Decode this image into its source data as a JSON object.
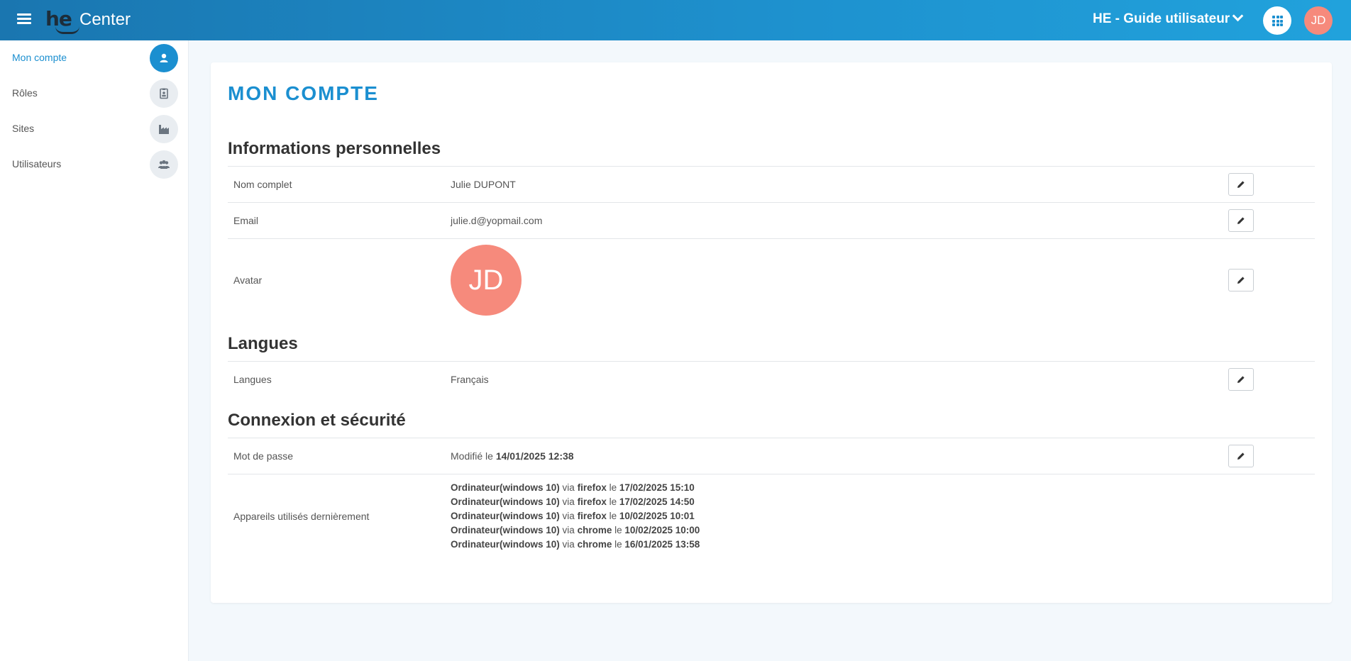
{
  "app": {
    "name": "Center",
    "logo_text": "he"
  },
  "header": {
    "site_selector": "HE - Guide utilisateur",
    "avatar_initials": "JD"
  },
  "colors": {
    "brand": "#1b8fd0",
    "avatar": "#f68a7c",
    "topbar_start": "#1a76b0",
    "topbar_end": "#21a2dc"
  },
  "sidebar": {
    "items": [
      {
        "label": "Mon compte",
        "icon": "user-icon",
        "active": true
      },
      {
        "label": "Rôles",
        "icon": "badge-icon",
        "active": false
      },
      {
        "label": "Sites",
        "icon": "factory-icon",
        "active": false
      },
      {
        "label": "Utilisateurs",
        "icon": "users-icon",
        "active": false
      }
    ]
  },
  "main": {
    "title": "MON COMPTE",
    "sections": {
      "personal": {
        "title": "Informations personnelles",
        "full_name_label": "Nom complet",
        "full_name": "Julie DUPONT",
        "email_label": "Email",
        "email": "julie.d@yopmail.com",
        "avatar_label": "Avatar",
        "avatar_initials": "JD"
      },
      "languages": {
        "title": "Langues",
        "label": "Langues",
        "value": "Français"
      },
      "security": {
        "title": "Connexion et sécurité",
        "password_label": "Mot de passe",
        "password_prefix": "Modifié le",
        "password_date": "14/01/2025 12:38",
        "devices_label": "Appareils utilisés dernièrement",
        "devices": [
          {
            "device": "Ordinateur(windows 10)",
            "via": "via",
            "browser": "firefox",
            "le": "le",
            "date": "17/02/2025 15:10"
          },
          {
            "device": "Ordinateur(windows 10)",
            "via": "via",
            "browser": "firefox",
            "le": "le",
            "date": "17/02/2025 14:50"
          },
          {
            "device": "Ordinateur(windows 10)",
            "via": "via",
            "browser": "firefox",
            "le": "le",
            "date": "10/02/2025 10:01"
          },
          {
            "device": "Ordinateur(windows 10)",
            "via": "via",
            "browser": "chrome",
            "le": "le",
            "date": "10/02/2025 10:00"
          },
          {
            "device": "Ordinateur(windows 10)",
            "via": "via",
            "browser": "chrome",
            "le": "le",
            "date": "16/01/2025 13:58"
          }
        ]
      }
    }
  }
}
